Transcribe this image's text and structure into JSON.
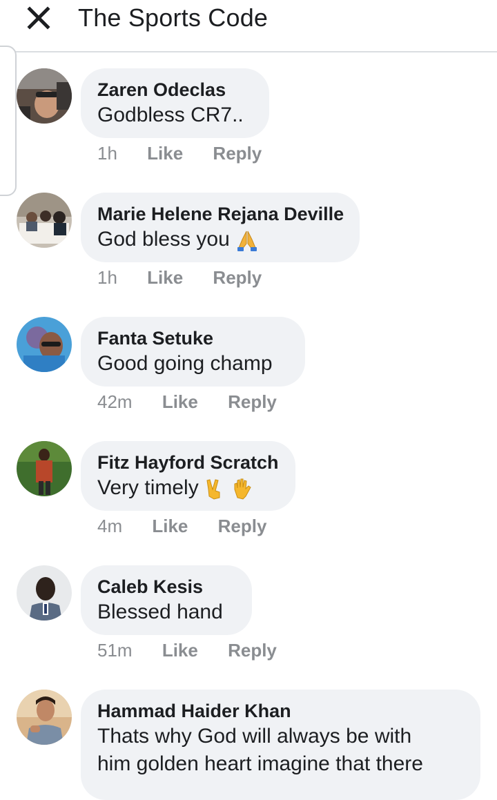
{
  "header": {
    "title": "The Sports Code",
    "close_icon": "close-icon"
  },
  "comments": [
    {
      "author": "Zaren Odeclas",
      "text": "Godbless CR7..",
      "time": "1h",
      "like": "Like",
      "reply": "Reply"
    },
    {
      "author": "Marie Helene Rejana Deville",
      "text": "God bless you",
      "emoji": "folded-hands-icon",
      "time": "1h",
      "like": "Like",
      "reply": "Reply"
    },
    {
      "author": "Fanta Setuke",
      "text": "Good going champ",
      "time": "42m",
      "like": "Like",
      "reply": "Reply"
    },
    {
      "author": "Fitz Hayford Scratch",
      "text": "Very timely",
      "emoji": "victory-hand-icon raised-hand-icon",
      "time": "4m",
      "like": "Like",
      "reply": "Reply"
    },
    {
      "author": "Caleb Kesis",
      "text": "Blessed hand",
      "time": "51m",
      "like": "Like",
      "reply": "Reply"
    },
    {
      "author": "Hammad Haider Khan",
      "text_line1": "Thats why God will always be with",
      "text_line2": "him golden heart imagine that there"
    }
  ],
  "colors": {
    "bubble_bg": "#f0f2f5",
    "meta_text": "#8a8d91",
    "divider": "#dadde1"
  }
}
